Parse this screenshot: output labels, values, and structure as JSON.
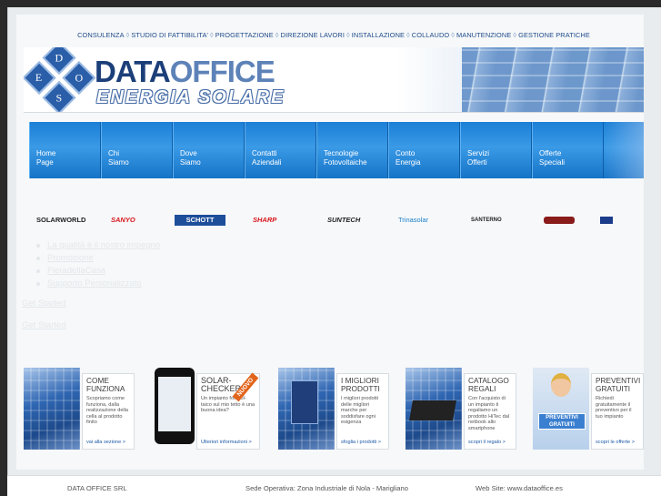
{
  "topnav": [
    "CONSULENZA",
    "STUDIO DI FATTIBILITA'",
    "PROGETTAZIONE",
    "DIREZIONE LAVORI",
    "INSTALLAZIONE",
    "COLLAUDO",
    "MANUTENZIONE",
    "GESTIONE PRATICHE"
  ],
  "topnav_sep": "◊",
  "logo": {
    "letters": [
      "D",
      "O",
      "E",
      "S"
    ]
  },
  "brand": {
    "line1a": "DATA",
    "line1b": "OFFICE",
    "line2": "ENERGIA SOLARE"
  },
  "menu": [
    {
      "l1": "Home",
      "l2": "Page"
    },
    {
      "l1": "Chi",
      "l2": "Siamo"
    },
    {
      "l1": "Dove",
      "l2": "Siamo"
    },
    {
      "l1": "Contatti",
      "l2": "Aziendali"
    },
    {
      "l1": "Tecnologie",
      "l2": "Fotovoltaiche"
    },
    {
      "l1": "Conto",
      "l2": "Energia"
    },
    {
      "l1": "Servizi",
      "l2": "Offerti"
    },
    {
      "l1": "Offerte",
      "l2": "Speciali"
    }
  ],
  "brands": [
    "SOLARWORLD",
    "SANYO",
    "SCHOTT",
    "SHARP",
    "SUNTECH",
    "Trinasolar",
    "SANTERNO",
    "",
    ""
  ],
  "brand_colors": [
    "#222222",
    "#d8141b",
    "#ffffff",
    "#d8141b",
    "#222222",
    "#1a7fc8",
    "#222222",
    "#222222",
    "#1a3c8a"
  ],
  "links": [
    "La qualità è il nostro impegno",
    "Promozione",
    "FieradellaCasa",
    "Supporto Personalizzato"
  ],
  "get_started": [
    "Get Started",
    "Get Started"
  ],
  "promos": [
    {
      "title": "COME FUNZIONA",
      "desc": "Scopriamo come funziona, dalla realizzazione della cella al prodotto finito",
      "link": "vai alla sezione >"
    },
    {
      "title": "SOLAR-CHECKER",
      "badge": "NUOVO",
      "desc": "Un impianto fotovol-taico sul mio tetto è una buona idea?",
      "link": "Ulteriori informazioni >"
    },
    {
      "title": "I MIGLIORI PRODOTTI",
      "desc": "I migliori prodotti delle migliori marche per soddisfare ogni esigenza",
      "link": "sfoglia i prodotti >"
    },
    {
      "title": "CATALOGO REGALI",
      "desc": "Con l'acquisto di un impianto ti regaliamo un prodotto HiTec dal netbook allo smartphone",
      "link": "scopri il regalo >"
    },
    {
      "title": "PREVENTIVI GRATUITI",
      "image_text": "PREVENTIVI GRATUITI",
      "desc": "Richiedi gratuitamente il preventivo per il tuo impianto",
      "link": "scopri le offerte >"
    }
  ],
  "footer": {
    "company": "DATA OFFICE SRL",
    "address": "Sede Operativa: Zona Industriale di Nola - Marigliano",
    "website": "Web Site: www.dataoffice.es"
  }
}
